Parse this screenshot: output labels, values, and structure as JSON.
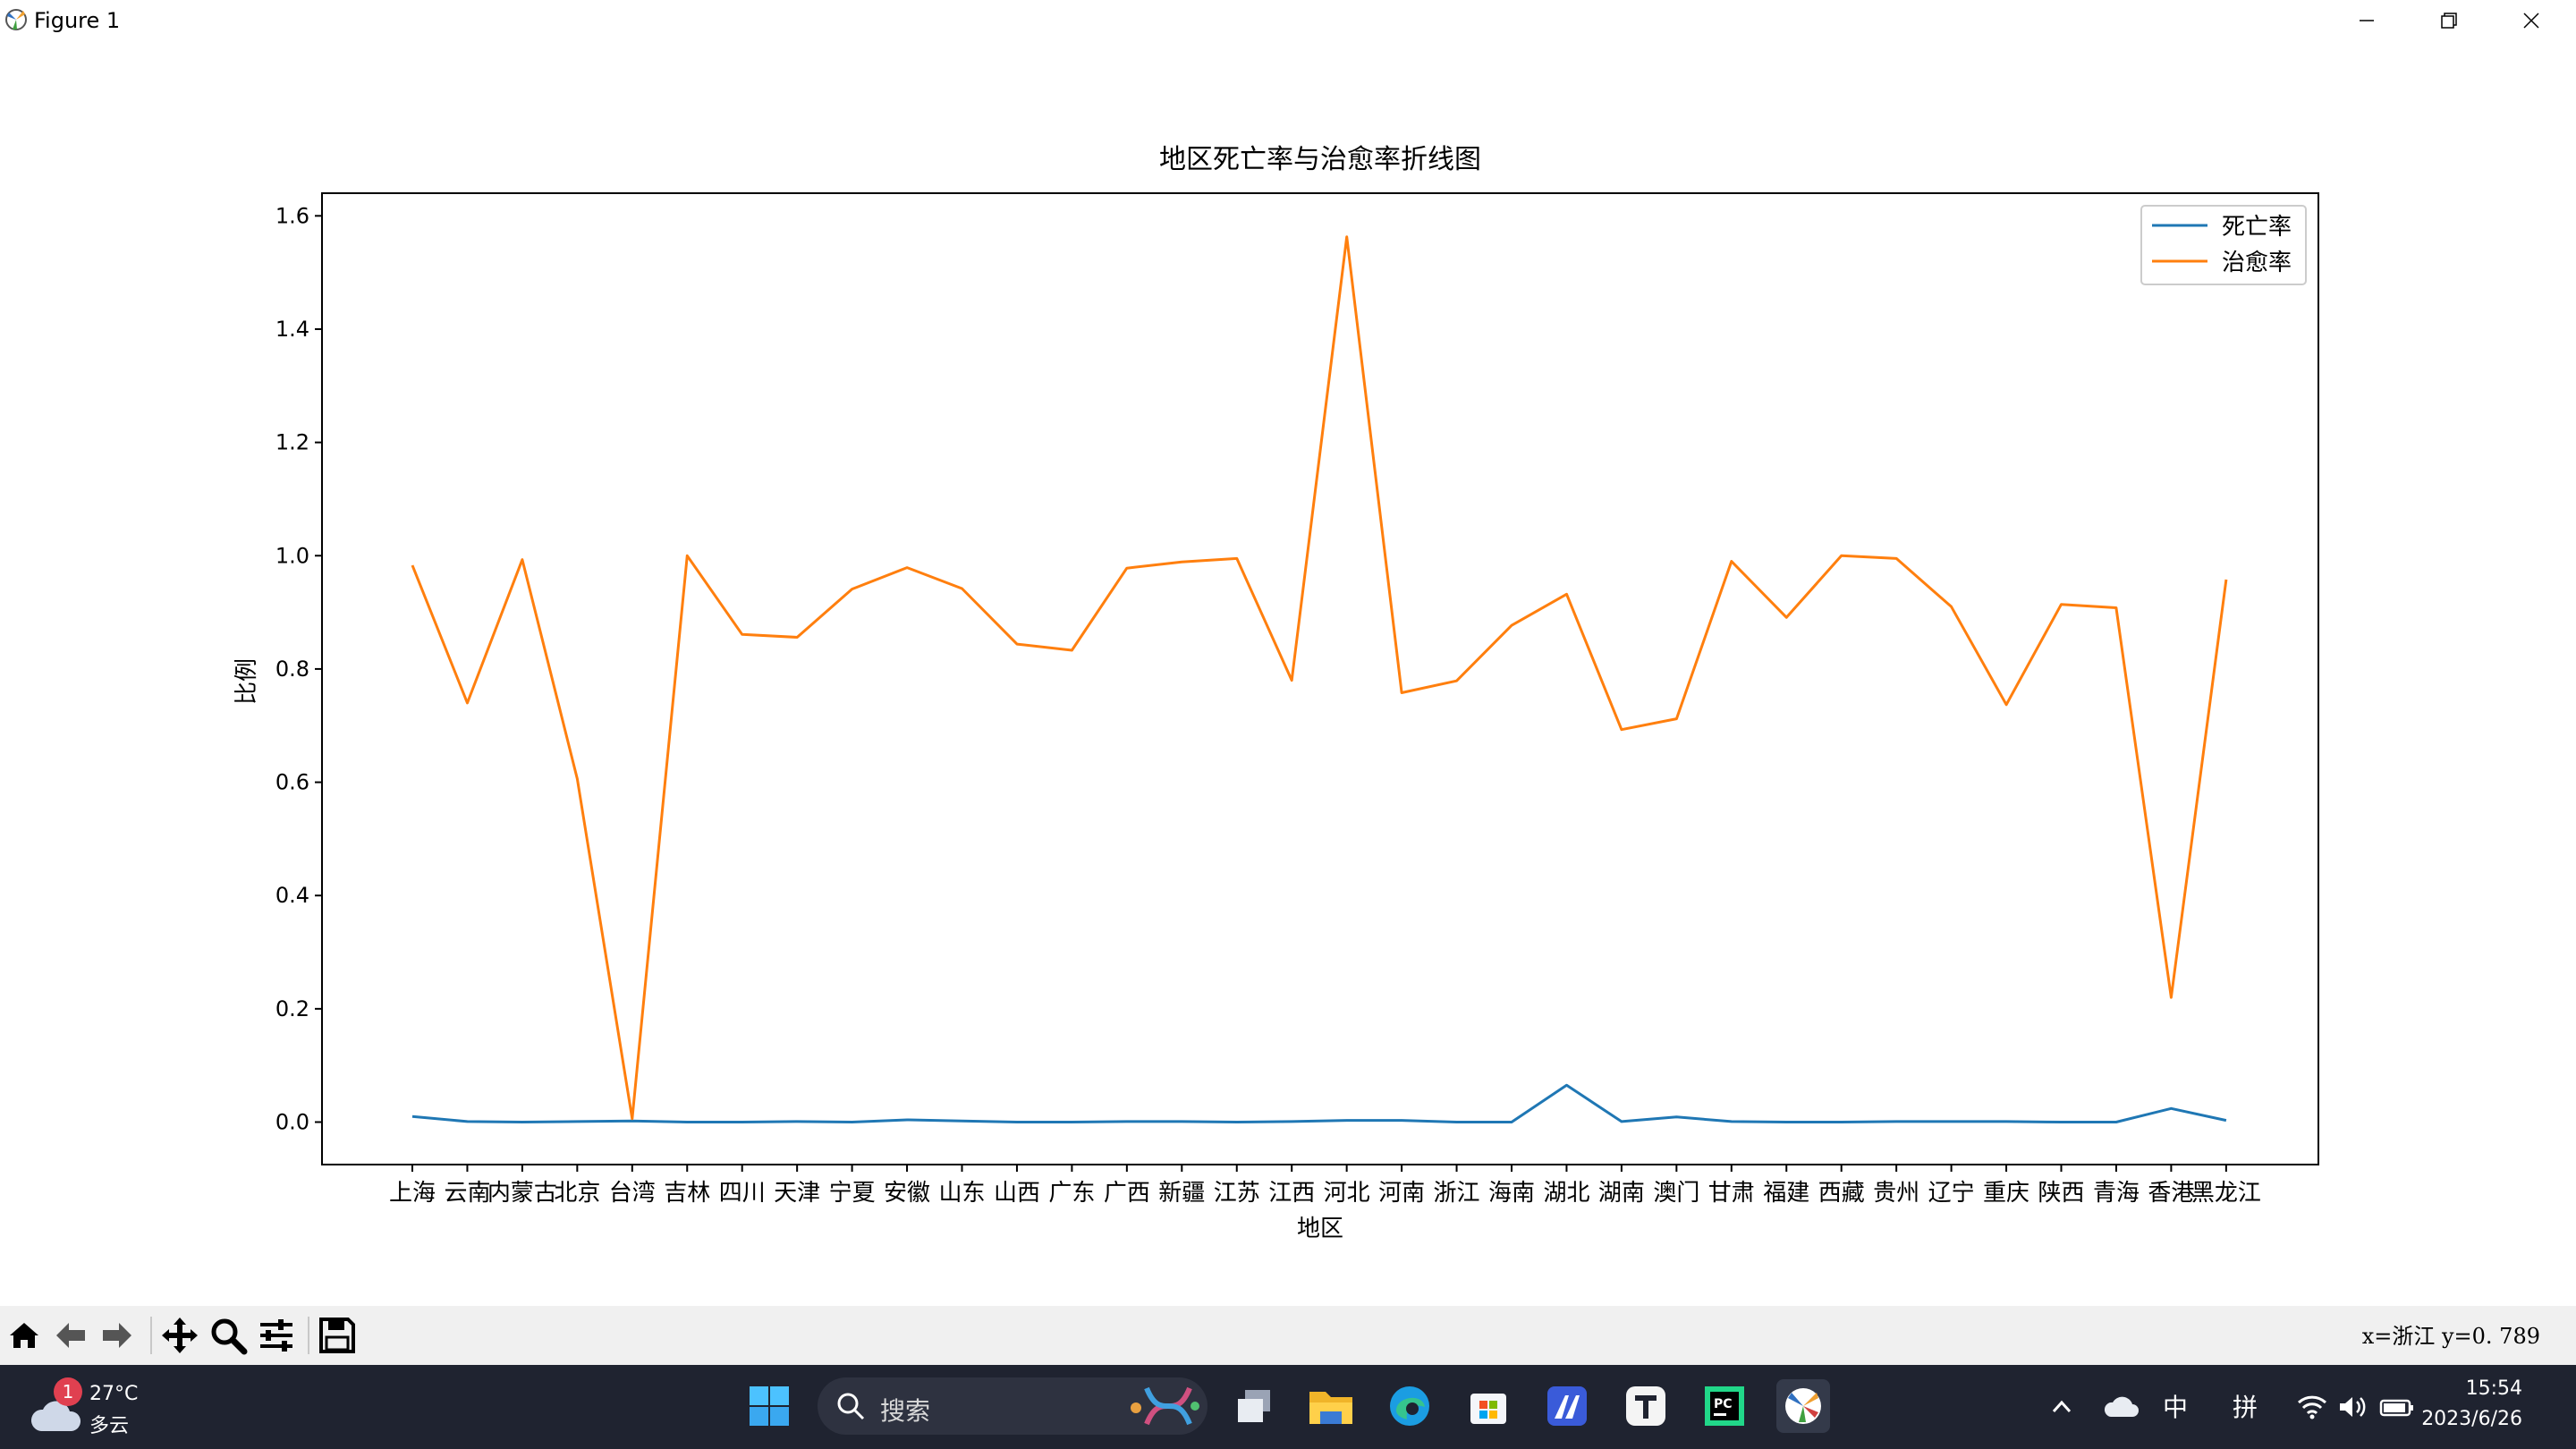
{
  "window": {
    "title": "Figure 1",
    "controls": [
      "minimize-icon",
      "maximize-icon",
      "close-icon"
    ]
  },
  "chart_data": {
    "type": "line",
    "title": "地区死亡率与治愈率折线图",
    "xlabel": "地区",
    "ylabel": "比例",
    "categories": [
      "上海",
      "云南",
      "内蒙古",
      "北京",
      "台湾",
      "吉林",
      "四川",
      "天津",
      "宁夏",
      "安徽",
      "山东",
      "山西",
      "广东",
      "广西",
      "新疆",
      "江苏",
      "江西",
      "河北",
      "河南",
      "浙江",
      "海南",
      "湖北",
      "湖南",
      "澳门",
      "甘肃",
      "福建",
      "西藏",
      "贵州",
      "辽宁",
      "重庆",
      "陕西",
      "青海",
      "香港",
      "黑龙江"
    ],
    "series": [
      {
        "name": "死亡率",
        "color": "#1f77b4",
        "values": [
          0.01,
          0.001,
          0.0,
          0.001,
          0.002,
          0.0,
          0.0,
          0.001,
          0.0,
          0.004,
          0.002,
          0.0,
          0.0,
          0.001,
          0.001,
          0.0,
          0.001,
          0.003,
          0.003,
          0.0,
          0.0,
          0.065,
          0.001,
          0.009,
          0.001,
          0.0,
          0.0,
          0.001,
          0.001,
          0.001,
          0.0,
          0.0,
          0.024,
          0.003
        ]
      },
      {
        "name": "治愈率",
        "color": "#ff7f0e",
        "values": [
          0.983,
          0.74,
          0.993,
          0.606,
          0.006,
          1.0,
          0.861,
          0.856,
          0.941,
          0.979,
          0.942,
          0.844,
          0.833,
          0.978,
          0.989,
          0.995,
          0.78,
          1.563,
          0.758,
          0.779,
          0.877,
          0.932,
          0.693,
          0.712,
          0.99,
          0.891,
          1.0,
          0.995,
          0.91,
          0.737,
          0.914,
          0.908,
          0.22,
          0.958
        ]
      }
    ],
    "ylim": [
      -0.075,
      1.64
    ],
    "yticks": [
      "0.0",
      "0.2",
      "0.4",
      "0.6",
      "0.8",
      "1.0",
      "1.2",
      "1.4",
      "1.6"
    ],
    "legend": "top-right",
    "grid": false
  },
  "toolbar": {
    "buttons": [
      "home-icon",
      "back-icon",
      "forward-icon",
      "pan-icon",
      "zoom-icon",
      "configure-icon",
      "save-icon"
    ],
    "coords": "x=浙江  y=0. 789"
  },
  "taskbar": {
    "weather_temp": "27°C",
    "weather_cond": "多云",
    "weather_badge": "1",
    "search_placeholder": "搜索",
    "tray_ime_1": "中",
    "tray_ime_2": "拼",
    "time": "15:54",
    "date": "2023/6/26"
  }
}
